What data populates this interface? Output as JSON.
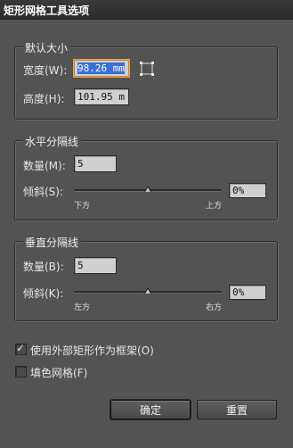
{
  "window": {
    "title": "矩形网格工具选项"
  },
  "default_size": {
    "legend": "默认大小",
    "width_label": "宽度(W):",
    "width_value": "98.26 mm",
    "height_label": "高度(H):",
    "height_value": "101.95 m"
  },
  "horizontal_dividers": {
    "legend": "水平分隔线",
    "number_label": "数量(M):",
    "number_value": "5",
    "skew_label": "倾斜(S):",
    "skew_value": "0%",
    "skew_position": 0.5,
    "left_label": "下方",
    "right_label": "上方"
  },
  "vertical_dividers": {
    "legend": "垂直分隔线",
    "number_label": "数量(B):",
    "number_value": "5",
    "skew_label": "倾斜(K):",
    "skew_value": "0%",
    "skew_position": 0.5,
    "left_label": "左方",
    "right_label": "右方"
  },
  "options": {
    "use_outer_rect_label": "使用外部矩形作为框架(O)",
    "use_outer_rect_checked": true,
    "fill_grid_label": "填色网格(F)",
    "fill_grid_checked": false
  },
  "buttons": {
    "ok_label": "确定",
    "reset_label": "重置"
  },
  "icons": {
    "reference_point": "grid-reference-point-icon",
    "checkmark": "checkmark-icon"
  }
}
